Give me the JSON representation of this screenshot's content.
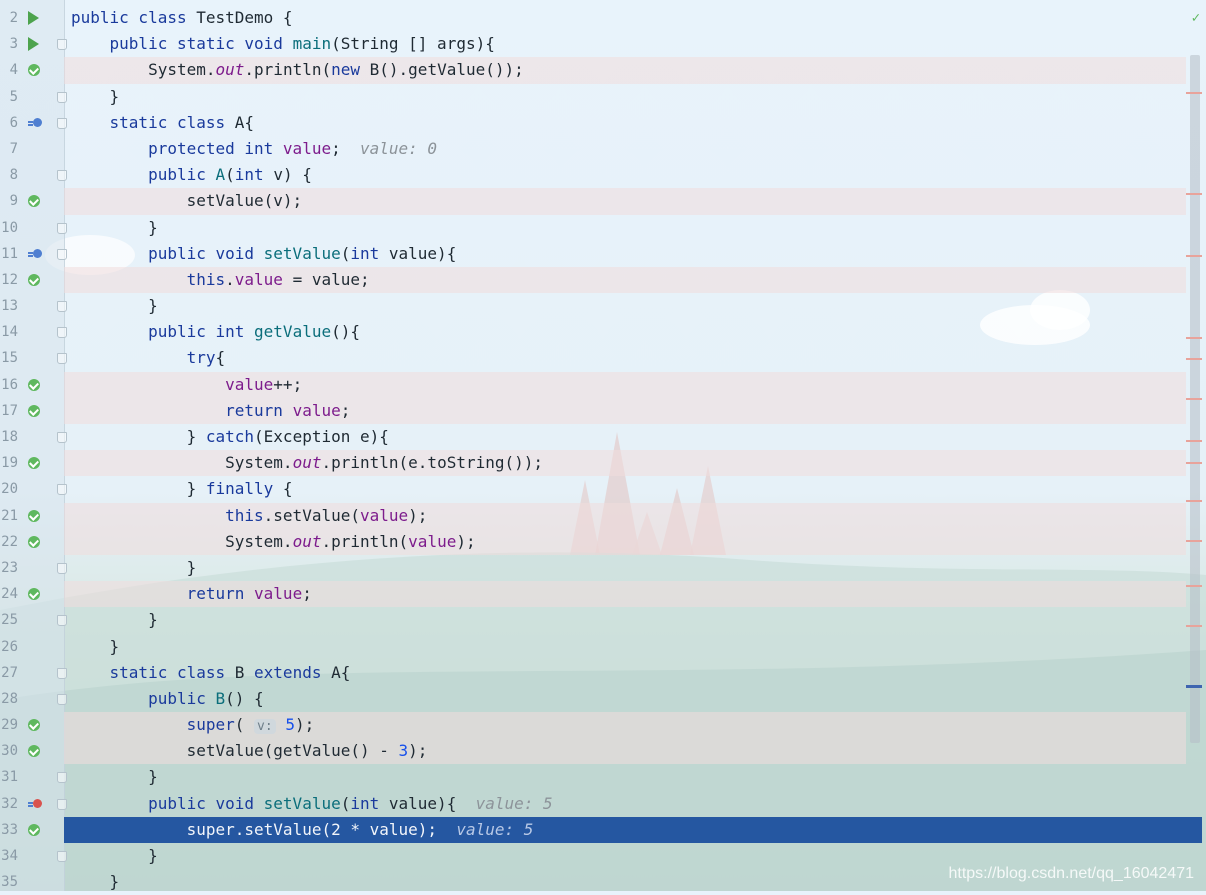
{
  "lines": [
    {
      "num": "2",
      "gutter": "run",
      "bp": false,
      "sel": false,
      "fold": false,
      "code": [
        [
          "kw",
          "public class "
        ],
        [
          "t",
          "TestDemo {"
        ]
      ]
    },
    {
      "num": "3",
      "gutter": "run",
      "bp": false,
      "sel": false,
      "fold": true,
      "code": [
        [
          "t",
          "    "
        ],
        [
          "kw",
          "public static void "
        ],
        [
          "fn",
          "main"
        ],
        [
          "t",
          "(String [] args){"
        ]
      ]
    },
    {
      "num": "4",
      "gutter": "ok",
      "bp": true,
      "sel": false,
      "fold": false,
      "code": [
        [
          "t",
          "        System."
        ],
        [
          "ital",
          "out"
        ],
        [
          "t",
          ".println("
        ],
        [
          "kw",
          "new "
        ],
        [
          "t",
          "B().getValue());"
        ]
      ]
    },
    {
      "num": "5",
      "gutter": "",
      "bp": false,
      "sel": false,
      "fold": true,
      "code": [
        [
          "t",
          "    }"
        ]
      ]
    },
    {
      "num": "6",
      "gutter": "ov",
      "bp": false,
      "sel": false,
      "fold": true,
      "code": [
        [
          "t",
          "    "
        ],
        [
          "kw",
          "static class "
        ],
        [
          "t",
          "A{"
        ]
      ]
    },
    {
      "num": "7",
      "gutter": "",
      "bp": false,
      "sel": false,
      "fold": false,
      "code": [
        [
          "t",
          "        "
        ],
        [
          "kw",
          "protected int "
        ],
        [
          "fld",
          "value"
        ],
        [
          "t",
          ";  "
        ],
        [
          "hint",
          "value: 0"
        ]
      ]
    },
    {
      "num": "8",
      "gutter": "",
      "bp": false,
      "sel": false,
      "fold": true,
      "code": [
        [
          "t",
          "        "
        ],
        [
          "kw",
          "public "
        ],
        [
          "fn",
          "A"
        ],
        [
          "t",
          "("
        ],
        [
          "kw",
          "int "
        ],
        [
          "t",
          "v) {"
        ]
      ]
    },
    {
      "num": "9",
      "gutter": "ok",
      "bp": true,
      "sel": false,
      "fold": false,
      "code": [
        [
          "t",
          "            setValue(v);"
        ]
      ]
    },
    {
      "num": "10",
      "gutter": "",
      "bp": false,
      "sel": false,
      "fold": true,
      "code": [
        [
          "t",
          "        }"
        ]
      ]
    },
    {
      "num": "11",
      "gutter": "ov",
      "bp": false,
      "sel": false,
      "fold": true,
      "code": [
        [
          "t",
          "        "
        ],
        [
          "kw",
          "public void "
        ],
        [
          "fn",
          "setValue"
        ],
        [
          "t",
          "("
        ],
        [
          "kw",
          "int "
        ],
        [
          "t",
          "value){"
        ]
      ]
    },
    {
      "num": "12",
      "gutter": "ok",
      "bp": true,
      "sel": false,
      "fold": false,
      "code": [
        [
          "t",
          "            "
        ],
        [
          "kw",
          "this"
        ],
        [
          "t",
          "."
        ],
        [
          "fld",
          "value"
        ],
        [
          "t",
          " = value;"
        ]
      ]
    },
    {
      "num": "13",
      "gutter": "",
      "bp": false,
      "sel": false,
      "fold": true,
      "code": [
        [
          "t",
          "        }"
        ]
      ]
    },
    {
      "num": "14",
      "gutter": "",
      "bp": false,
      "sel": false,
      "fold": true,
      "code": [
        [
          "t",
          "        "
        ],
        [
          "kw",
          "public int "
        ],
        [
          "fn",
          "getValue"
        ],
        [
          "t",
          "(){"
        ]
      ]
    },
    {
      "num": "15",
      "gutter": "",
      "bp": false,
      "sel": false,
      "fold": true,
      "code": [
        [
          "t",
          "            "
        ],
        [
          "kw",
          "try"
        ],
        [
          "t",
          "{"
        ]
      ]
    },
    {
      "num": "16",
      "gutter": "ok",
      "bp": true,
      "sel": false,
      "fold": false,
      "code": [
        [
          "t",
          "                "
        ],
        [
          "fld",
          "value"
        ],
        [
          "t",
          "++;"
        ]
      ]
    },
    {
      "num": "17",
      "gutter": "ok",
      "bp": true,
      "sel": false,
      "fold": false,
      "code": [
        [
          "t",
          "                "
        ],
        [
          "kw",
          "return "
        ],
        [
          "fld",
          "value"
        ],
        [
          "t",
          ";"
        ]
      ]
    },
    {
      "num": "18",
      "gutter": "",
      "bp": false,
      "sel": false,
      "fold": true,
      "code": [
        [
          "t",
          "            } "
        ],
        [
          "kw",
          "catch"
        ],
        [
          "t",
          "(Exception e){"
        ]
      ]
    },
    {
      "num": "19",
      "gutter": "ok",
      "bp": true,
      "sel": false,
      "fold": false,
      "code": [
        [
          "t",
          "                System."
        ],
        [
          "ital",
          "out"
        ],
        [
          "t",
          ".println(e.toString());"
        ]
      ]
    },
    {
      "num": "20",
      "gutter": "",
      "bp": false,
      "sel": false,
      "fold": true,
      "code": [
        [
          "t",
          "            } "
        ],
        [
          "kw",
          "finally "
        ],
        [
          "t",
          "{"
        ]
      ]
    },
    {
      "num": "21",
      "gutter": "ok",
      "bp": true,
      "sel": false,
      "fold": false,
      "code": [
        [
          "t",
          "                "
        ],
        [
          "kw",
          "this"
        ],
        [
          "t",
          ".setValue("
        ],
        [
          "fld",
          "value"
        ],
        [
          "t",
          ");"
        ]
      ]
    },
    {
      "num": "22",
      "gutter": "ok",
      "bp": true,
      "sel": false,
      "fold": false,
      "code": [
        [
          "t",
          "                System."
        ],
        [
          "ital",
          "out"
        ],
        [
          "t",
          ".println("
        ],
        [
          "fld",
          "value"
        ],
        [
          "t",
          ");"
        ]
      ]
    },
    {
      "num": "23",
      "gutter": "",
      "bp": false,
      "sel": false,
      "fold": true,
      "code": [
        [
          "t",
          "            }"
        ]
      ]
    },
    {
      "num": "24",
      "gutter": "ok",
      "bp": true,
      "sel": false,
      "fold": false,
      "code": [
        [
          "t",
          "            "
        ],
        [
          "kw",
          "return "
        ],
        [
          "fld",
          "value"
        ],
        [
          "t",
          ";"
        ]
      ]
    },
    {
      "num": "25",
      "gutter": "",
      "bp": false,
      "sel": false,
      "fold": true,
      "code": [
        [
          "t",
          "        }"
        ]
      ]
    },
    {
      "num": "26",
      "gutter": "",
      "bp": false,
      "sel": false,
      "fold": false,
      "code": [
        [
          "t",
          "    }"
        ]
      ]
    },
    {
      "num": "27",
      "gutter": "",
      "bp": false,
      "sel": false,
      "fold": true,
      "code": [
        [
          "t",
          "    "
        ],
        [
          "kw",
          "static class "
        ],
        [
          "t",
          "B "
        ],
        [
          "kw",
          "extends "
        ],
        [
          "t",
          "A{"
        ]
      ]
    },
    {
      "num": "28",
      "gutter": "",
      "bp": false,
      "sel": false,
      "fold": true,
      "code": [
        [
          "t",
          "        "
        ],
        [
          "kw",
          "public "
        ],
        [
          "fn",
          "B"
        ],
        [
          "t",
          "() {"
        ]
      ]
    },
    {
      "num": "29",
      "gutter": "ok",
      "bp": true,
      "sel": false,
      "fold": false,
      "code": [
        [
          "t",
          "            "
        ],
        [
          "kw",
          "super"
        ],
        [
          "t",
          "( "
        ],
        [
          "ph",
          "v:"
        ],
        [
          "t",
          " "
        ],
        [
          "num",
          "5"
        ],
        [
          "t",
          ");"
        ]
      ]
    },
    {
      "num": "30",
      "gutter": "ok",
      "bp": true,
      "sel": false,
      "fold": false,
      "code": [
        [
          "t",
          "            setValue(getValue() - "
        ],
        [
          "num",
          "3"
        ],
        [
          "t",
          ");"
        ]
      ]
    },
    {
      "num": "31",
      "gutter": "",
      "bp": false,
      "sel": false,
      "fold": true,
      "code": [
        [
          "t",
          "        }"
        ]
      ]
    },
    {
      "num": "32",
      "gutter": "ov-red",
      "bp": false,
      "sel": false,
      "fold": true,
      "code": [
        [
          "t",
          "        "
        ],
        [
          "kw",
          "public void "
        ],
        [
          "fn",
          "setValue"
        ],
        [
          "t",
          "("
        ],
        [
          "kw",
          "int "
        ],
        [
          "t",
          "value){  "
        ],
        [
          "hint",
          "value: 5"
        ]
      ]
    },
    {
      "num": "33",
      "gutter": "ok",
      "bp": false,
      "sel": true,
      "fold": false,
      "code": [
        [
          "t",
          "            "
        ],
        [
          "kw",
          "super"
        ],
        [
          "t",
          ".setValue(2 * value);  "
        ],
        [
          "hint",
          "value: 5"
        ]
      ]
    },
    {
      "num": "34",
      "gutter": "",
      "bp": false,
      "sel": false,
      "fold": true,
      "code": [
        [
          "t",
          "        }"
        ]
      ]
    },
    {
      "num": "35",
      "gutter": "",
      "bp": false,
      "sel": false,
      "fold": false,
      "code": [
        [
          "t",
          "    }"
        ]
      ]
    }
  ],
  "watermark": "https://blog.csdn.net/qq_16042471",
  "colors": {
    "selection": "#2557a1",
    "keyword": "#1a3a9c",
    "field": "#7d1c8c",
    "method": "#0b6e7b",
    "breakpoint_line": "#f0dcdc"
  }
}
